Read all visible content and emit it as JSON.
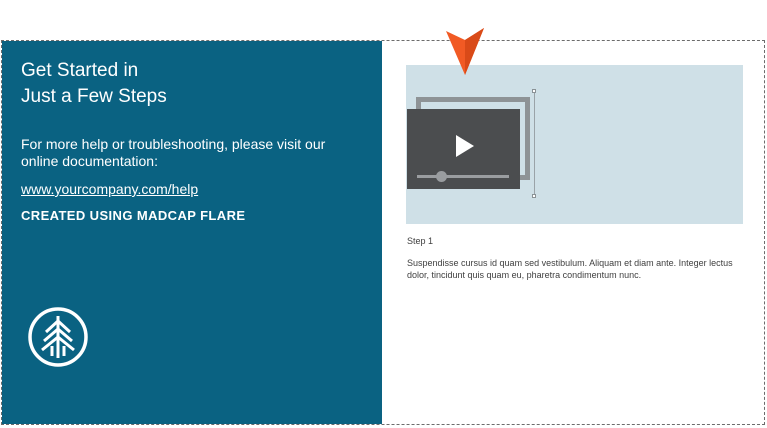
{
  "left_panel": {
    "heading_line1": "Get Started in",
    "heading_line2": "Just a Few Steps",
    "help_text": "For more help or troubleshooting, please visit our online documentation:",
    "help_link": "www.yourcompany.com/help",
    "credit": "CREATED USING MADCAP FLARE",
    "logo_icon": "tree-icon",
    "background_color": "#0a6282"
  },
  "media": {
    "background_color": "#cfe0e7",
    "player_icon": "play-icon",
    "pointer_icon": "pointer-arrow-icon",
    "pointer_color": "#f15a24",
    "progress_fraction": 0.22
  },
  "step": {
    "label": "Step 1",
    "body": "Suspendisse cursus id quam sed vestibulum. Aliquam et diam ante. Integer lectus dolor, tincidunt quis quam eu, pharetra condimentum nunc."
  }
}
